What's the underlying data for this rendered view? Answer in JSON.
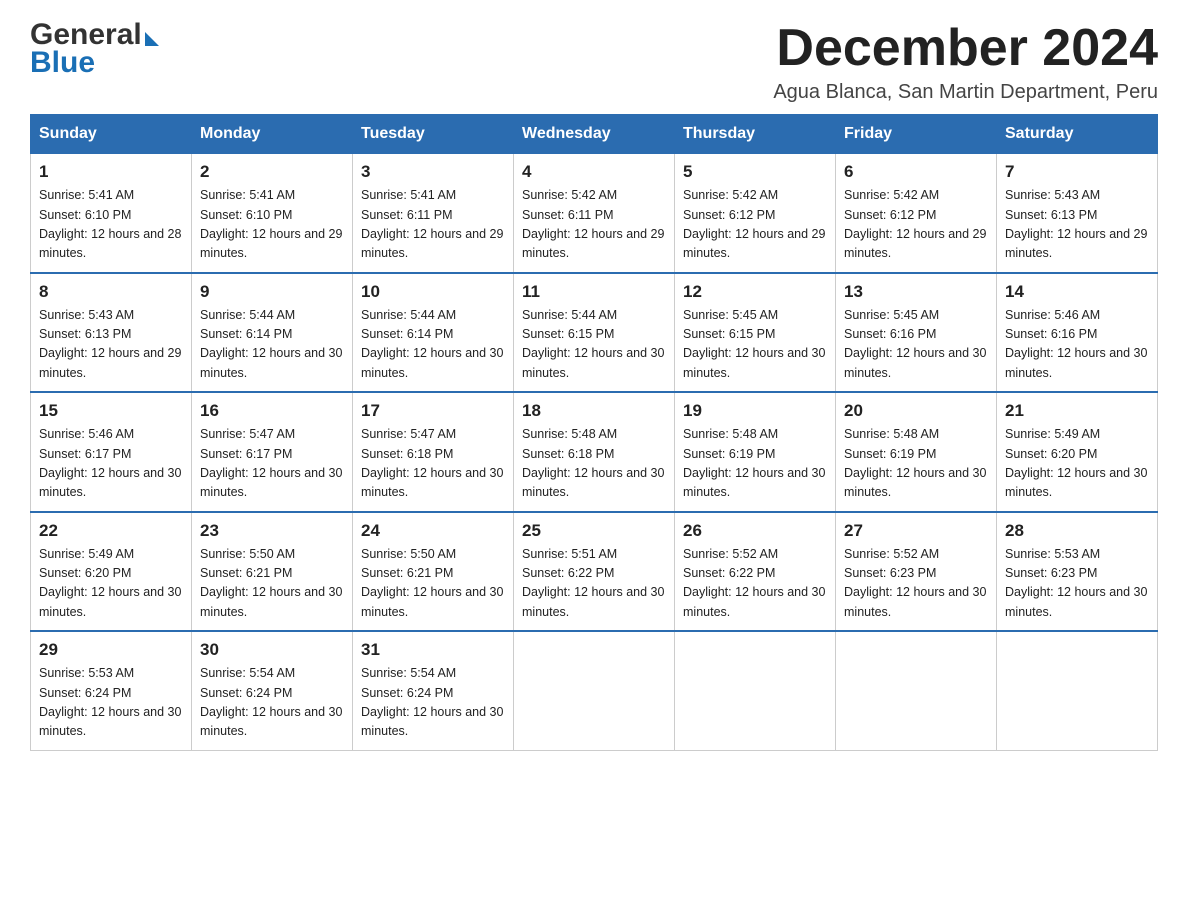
{
  "logo": {
    "general": "General",
    "blue": "Blue",
    "arrow": "▶"
  },
  "header": {
    "month_year": "December 2024",
    "location": "Agua Blanca, San Martin Department, Peru"
  },
  "weekdays": [
    "Sunday",
    "Monday",
    "Tuesday",
    "Wednesday",
    "Thursday",
    "Friday",
    "Saturday"
  ],
  "weeks": [
    [
      {
        "day": "1",
        "sunrise": "Sunrise: 5:41 AM",
        "sunset": "Sunset: 6:10 PM",
        "daylight": "Daylight: 12 hours and 28 minutes."
      },
      {
        "day": "2",
        "sunrise": "Sunrise: 5:41 AM",
        "sunset": "Sunset: 6:10 PM",
        "daylight": "Daylight: 12 hours and 29 minutes."
      },
      {
        "day": "3",
        "sunrise": "Sunrise: 5:41 AM",
        "sunset": "Sunset: 6:11 PM",
        "daylight": "Daylight: 12 hours and 29 minutes."
      },
      {
        "day": "4",
        "sunrise": "Sunrise: 5:42 AM",
        "sunset": "Sunset: 6:11 PM",
        "daylight": "Daylight: 12 hours and 29 minutes."
      },
      {
        "day": "5",
        "sunrise": "Sunrise: 5:42 AM",
        "sunset": "Sunset: 6:12 PM",
        "daylight": "Daylight: 12 hours and 29 minutes."
      },
      {
        "day": "6",
        "sunrise": "Sunrise: 5:42 AM",
        "sunset": "Sunset: 6:12 PM",
        "daylight": "Daylight: 12 hours and 29 minutes."
      },
      {
        "day": "7",
        "sunrise": "Sunrise: 5:43 AM",
        "sunset": "Sunset: 6:13 PM",
        "daylight": "Daylight: 12 hours and 29 minutes."
      }
    ],
    [
      {
        "day": "8",
        "sunrise": "Sunrise: 5:43 AM",
        "sunset": "Sunset: 6:13 PM",
        "daylight": "Daylight: 12 hours and 29 minutes."
      },
      {
        "day": "9",
        "sunrise": "Sunrise: 5:44 AM",
        "sunset": "Sunset: 6:14 PM",
        "daylight": "Daylight: 12 hours and 30 minutes."
      },
      {
        "day": "10",
        "sunrise": "Sunrise: 5:44 AM",
        "sunset": "Sunset: 6:14 PM",
        "daylight": "Daylight: 12 hours and 30 minutes."
      },
      {
        "day": "11",
        "sunrise": "Sunrise: 5:44 AM",
        "sunset": "Sunset: 6:15 PM",
        "daylight": "Daylight: 12 hours and 30 minutes."
      },
      {
        "day": "12",
        "sunrise": "Sunrise: 5:45 AM",
        "sunset": "Sunset: 6:15 PM",
        "daylight": "Daylight: 12 hours and 30 minutes."
      },
      {
        "day": "13",
        "sunrise": "Sunrise: 5:45 AM",
        "sunset": "Sunset: 6:16 PM",
        "daylight": "Daylight: 12 hours and 30 minutes."
      },
      {
        "day": "14",
        "sunrise": "Sunrise: 5:46 AM",
        "sunset": "Sunset: 6:16 PM",
        "daylight": "Daylight: 12 hours and 30 minutes."
      }
    ],
    [
      {
        "day": "15",
        "sunrise": "Sunrise: 5:46 AM",
        "sunset": "Sunset: 6:17 PM",
        "daylight": "Daylight: 12 hours and 30 minutes."
      },
      {
        "day": "16",
        "sunrise": "Sunrise: 5:47 AM",
        "sunset": "Sunset: 6:17 PM",
        "daylight": "Daylight: 12 hours and 30 minutes."
      },
      {
        "day": "17",
        "sunrise": "Sunrise: 5:47 AM",
        "sunset": "Sunset: 6:18 PM",
        "daylight": "Daylight: 12 hours and 30 minutes."
      },
      {
        "day": "18",
        "sunrise": "Sunrise: 5:48 AM",
        "sunset": "Sunset: 6:18 PM",
        "daylight": "Daylight: 12 hours and 30 minutes."
      },
      {
        "day": "19",
        "sunrise": "Sunrise: 5:48 AM",
        "sunset": "Sunset: 6:19 PM",
        "daylight": "Daylight: 12 hours and 30 minutes."
      },
      {
        "day": "20",
        "sunrise": "Sunrise: 5:48 AM",
        "sunset": "Sunset: 6:19 PM",
        "daylight": "Daylight: 12 hours and 30 minutes."
      },
      {
        "day": "21",
        "sunrise": "Sunrise: 5:49 AM",
        "sunset": "Sunset: 6:20 PM",
        "daylight": "Daylight: 12 hours and 30 minutes."
      }
    ],
    [
      {
        "day": "22",
        "sunrise": "Sunrise: 5:49 AM",
        "sunset": "Sunset: 6:20 PM",
        "daylight": "Daylight: 12 hours and 30 minutes."
      },
      {
        "day": "23",
        "sunrise": "Sunrise: 5:50 AM",
        "sunset": "Sunset: 6:21 PM",
        "daylight": "Daylight: 12 hours and 30 minutes."
      },
      {
        "day": "24",
        "sunrise": "Sunrise: 5:50 AM",
        "sunset": "Sunset: 6:21 PM",
        "daylight": "Daylight: 12 hours and 30 minutes."
      },
      {
        "day": "25",
        "sunrise": "Sunrise: 5:51 AM",
        "sunset": "Sunset: 6:22 PM",
        "daylight": "Daylight: 12 hours and 30 minutes."
      },
      {
        "day": "26",
        "sunrise": "Sunrise: 5:52 AM",
        "sunset": "Sunset: 6:22 PM",
        "daylight": "Daylight: 12 hours and 30 minutes."
      },
      {
        "day": "27",
        "sunrise": "Sunrise: 5:52 AM",
        "sunset": "Sunset: 6:23 PM",
        "daylight": "Daylight: 12 hours and 30 minutes."
      },
      {
        "day": "28",
        "sunrise": "Sunrise: 5:53 AM",
        "sunset": "Sunset: 6:23 PM",
        "daylight": "Daylight: 12 hours and 30 minutes."
      }
    ],
    [
      {
        "day": "29",
        "sunrise": "Sunrise: 5:53 AM",
        "sunset": "Sunset: 6:24 PM",
        "daylight": "Daylight: 12 hours and 30 minutes."
      },
      {
        "day": "30",
        "sunrise": "Sunrise: 5:54 AM",
        "sunset": "Sunset: 6:24 PM",
        "daylight": "Daylight: 12 hours and 30 minutes."
      },
      {
        "day": "31",
        "sunrise": "Sunrise: 5:54 AM",
        "sunset": "Sunset: 6:24 PM",
        "daylight": "Daylight: 12 hours and 30 minutes."
      },
      null,
      null,
      null,
      null
    ]
  ]
}
